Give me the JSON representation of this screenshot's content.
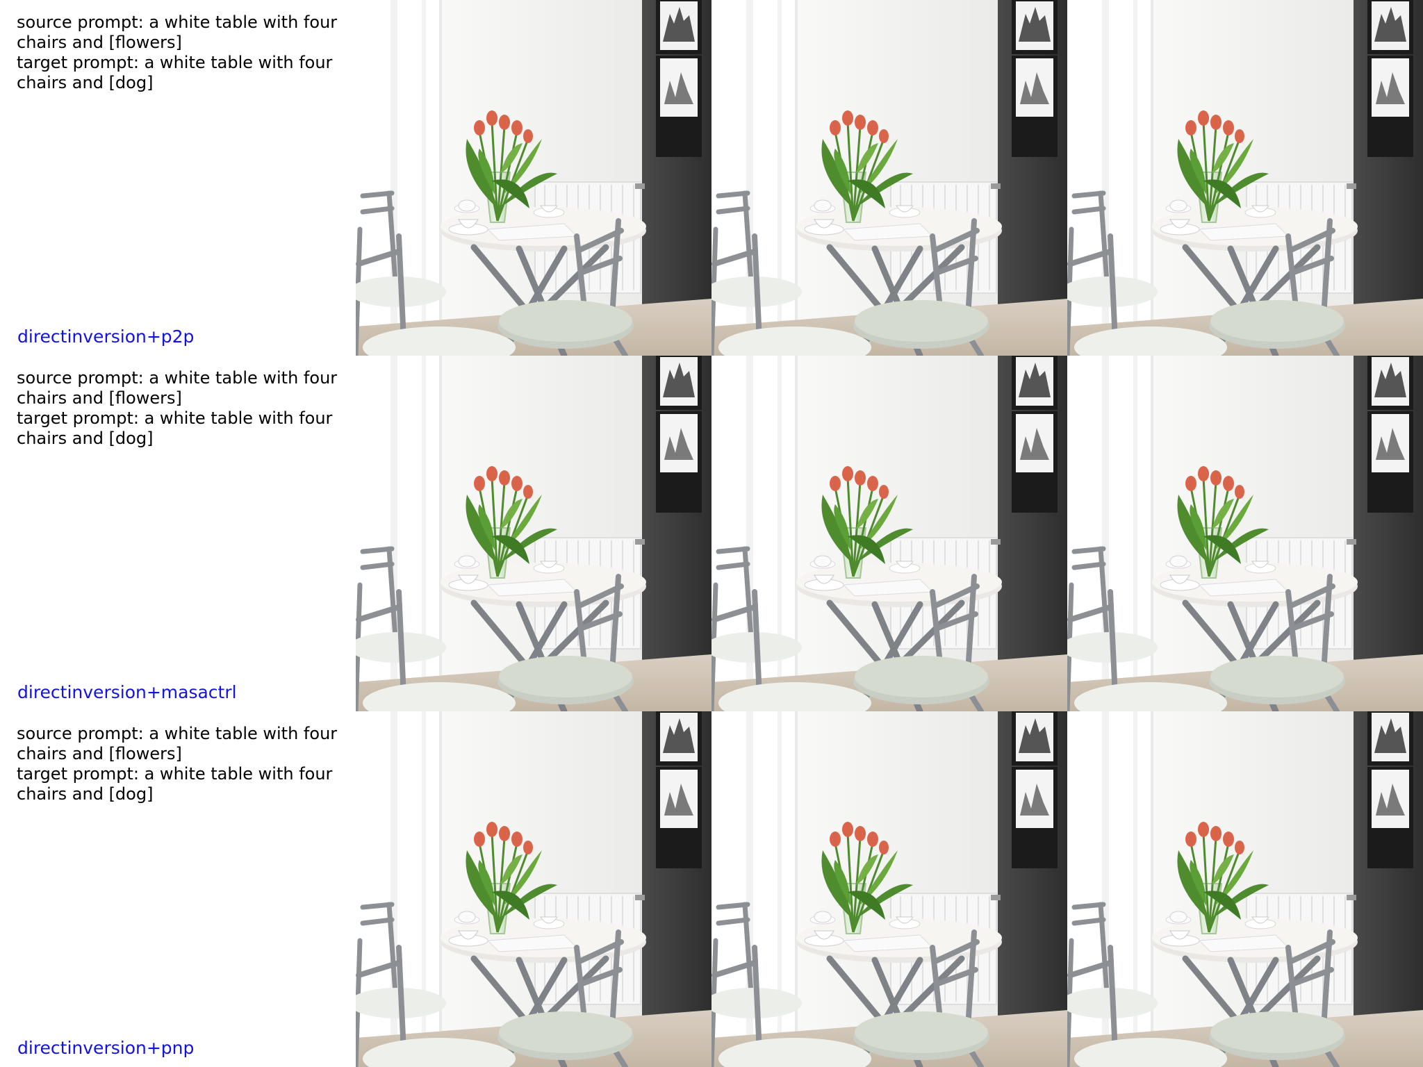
{
  "rows": [
    {
      "source_prompt": "source prompt: a white table with four chairs and [flowers]",
      "target_prompt": "target prompt: a white table with four chairs and [dog]",
      "method": "directinversion+p2p"
    },
    {
      "source_prompt": "source prompt: a white table with four chairs and [flowers]",
      "target_prompt": "target prompt: a white table with four chairs and [dog]",
      "method": "directinversion+masactrl"
    },
    {
      "source_prompt": "source prompt: a white table with four chairs and [flowers]",
      "target_prompt": "target prompt: a white table with four chairs and [dog]",
      "method": "directinversion+pnp"
    }
  ],
  "colors": {
    "background": "#ffffff",
    "prompt_text": "#000000",
    "method_text": "#1212e6",
    "wall": "#f4f4f2",
    "dark_wall": "#3c3c3c",
    "chair_metal": "#8c8f93",
    "seat": "#c9cec4",
    "leaves": "#4e8c2e",
    "tulip": "#d9644a"
  },
  "image_columns": [
    {
      "icon": "dining-room-photo-source"
    },
    {
      "icon": "dining-room-photo-edit-a"
    },
    {
      "icon": "dining-room-photo-edit-b"
    }
  ]
}
